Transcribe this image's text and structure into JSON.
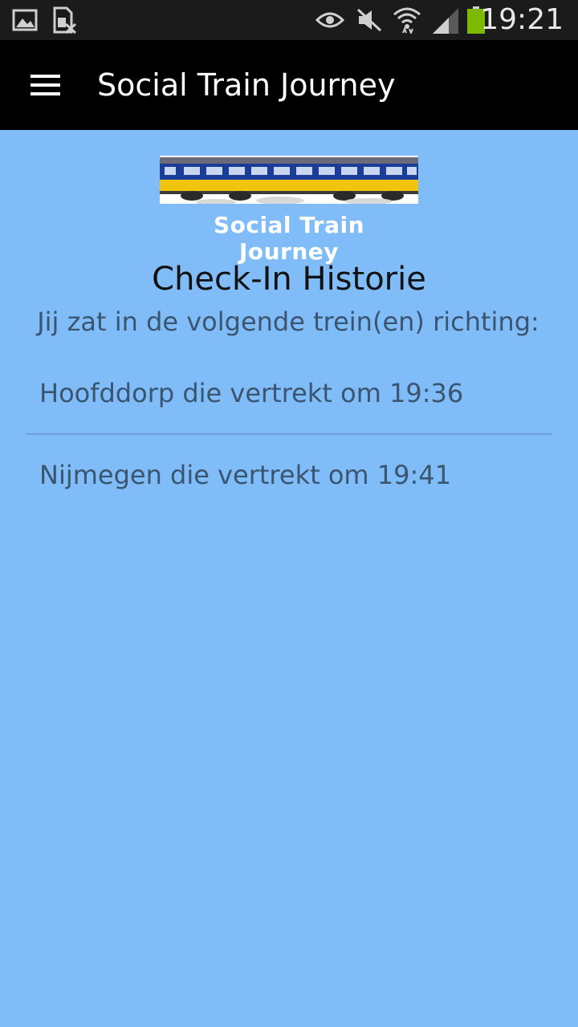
{
  "status_bar": {
    "time": "19:21",
    "icons": [
      "gallery-icon",
      "sim-card-icon",
      "eye-icon",
      "mute-icon",
      "wifi-icon",
      "signal-icon",
      "battery-icon"
    ],
    "battery_color": "#7cb900"
  },
  "app_bar": {
    "title": "Social Train Journey",
    "menu_icon": "hamburger-menu-icon"
  },
  "logo": {
    "text": "Social Train Journey"
  },
  "main": {
    "title": "Check-In Historie",
    "subtitle": "Jij zat in de volgende trein(en) richting:",
    "journeys": [
      {
        "label": "Hoofddorp die vertrekt om 19:36"
      },
      {
        "label": "Nijmegen die vertrekt om 19:41"
      }
    ]
  },
  "colors": {
    "background": "#80bcf7",
    "app_bar": "#000000",
    "status_bar": "#1b1b1b",
    "text_primary": "#111111",
    "text_secondary": "#3a5570"
  }
}
